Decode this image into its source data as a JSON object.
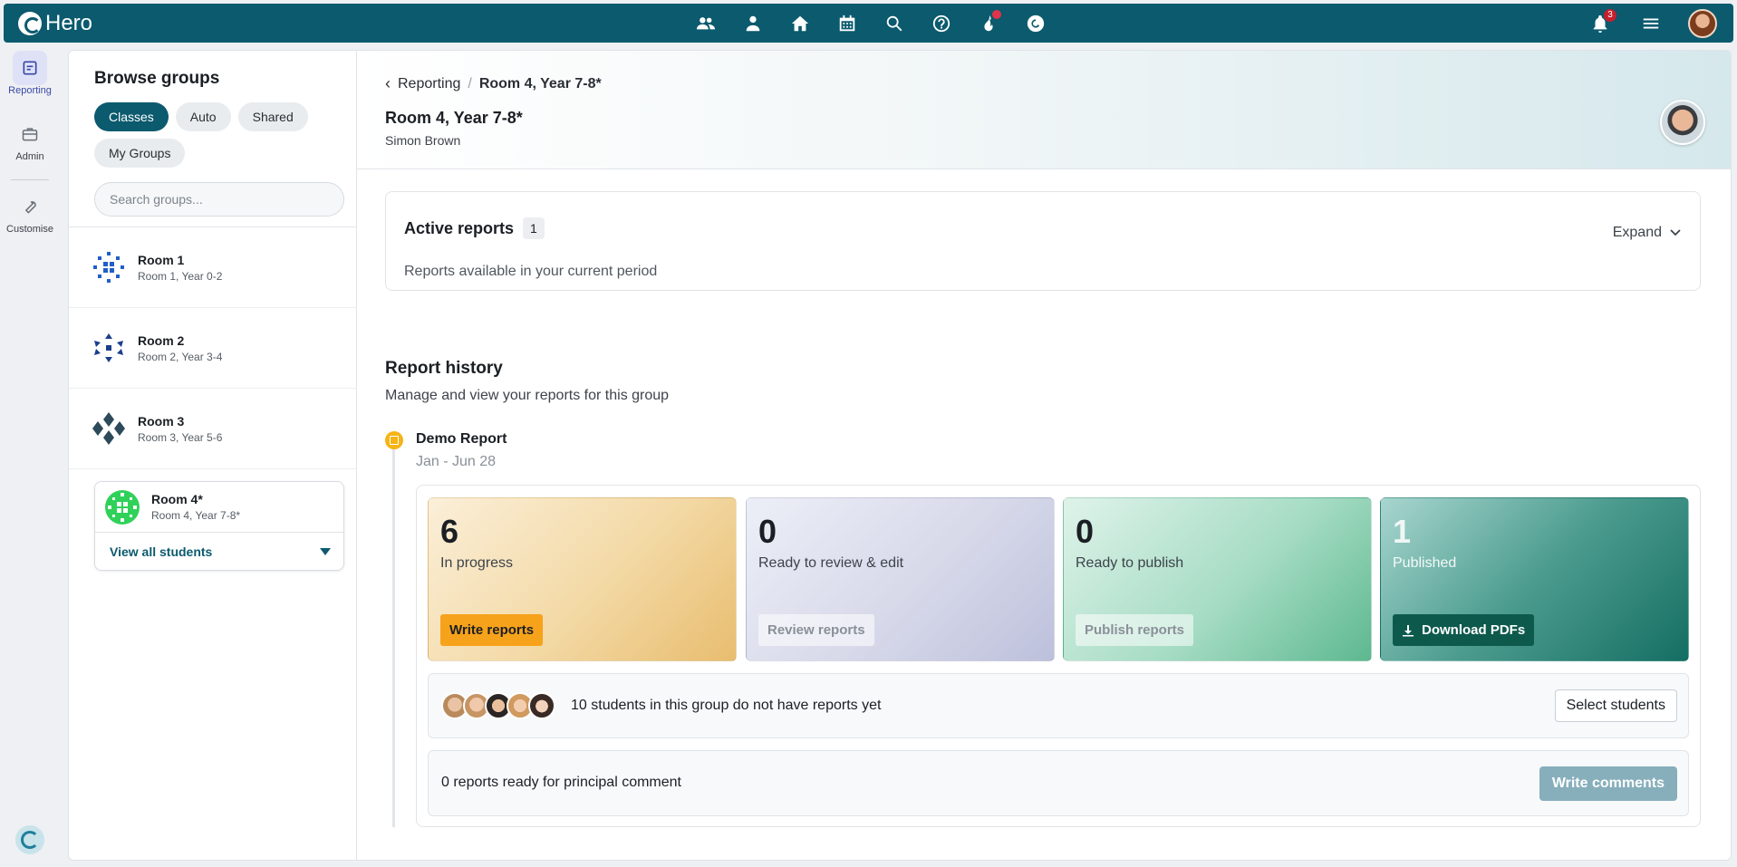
{
  "app": {
    "name": "Hero",
    "notification_count": "3"
  },
  "topnav": [
    "people-icon",
    "person-icon",
    "home-icon",
    "calendar-icon",
    "search-icon",
    "help-icon",
    "fire-icon",
    "hero-icon"
  ],
  "rail": {
    "items": [
      {
        "label": "Reporting",
        "icon": "report-icon",
        "active": true
      },
      {
        "label": "Admin",
        "icon": "briefcase-icon"
      },
      {
        "label": "Customise",
        "icon": "wrench-icon"
      }
    ]
  },
  "groups": {
    "title": "Browse groups",
    "filters": [
      "Classes",
      "Auto",
      "Shared",
      "My Groups"
    ],
    "search_placeholder": "Search groups...",
    "items": [
      {
        "name": "Room 1",
        "sub": "Room 1, Year 0-2"
      },
      {
        "name": "Room 2",
        "sub": "Room 2, Year 3-4"
      },
      {
        "name": "Room 3",
        "sub": "Room 3, Year 5-6"
      }
    ],
    "selected": {
      "name": "Room 4*",
      "sub": "Room 4, Year 7-8*",
      "view_label": "View all students"
    }
  },
  "header": {
    "breadcrumb_parent": "Reporting",
    "breadcrumb_sep": "/",
    "breadcrumb_current": "Room 4, Year 7-8*",
    "title": "Room 4, Year 7-8*",
    "subtitle": "Simon Brown"
  },
  "active_reports": {
    "title": "Active reports",
    "count": "1",
    "subtitle": "Reports available in your current period",
    "expand_label": "Expand"
  },
  "history": {
    "title": "Report history",
    "subtitle": "Manage and view your reports for this group",
    "report": {
      "name": "Demo Report",
      "dates": "Jan - Jun 28",
      "stats": [
        {
          "count": "6",
          "label": "In progress",
          "button": "Write reports"
        },
        {
          "count": "0",
          "label": "Ready to review & edit",
          "button": "Review reports"
        },
        {
          "count": "0",
          "label": "Ready to publish",
          "button": "Publish reports"
        },
        {
          "count": "1",
          "label": "Published",
          "button": "Download PDFs"
        }
      ],
      "students_text": "10 students in this group do not have reports yet",
      "select_students": "Select students",
      "comment_text": "0 reports ready for principal comment",
      "write_comments": "Write comments"
    }
  },
  "colors": {
    "brand": "#0b5a6e",
    "accent_orange": "#f7a21b",
    "published_green": "#156e62"
  }
}
